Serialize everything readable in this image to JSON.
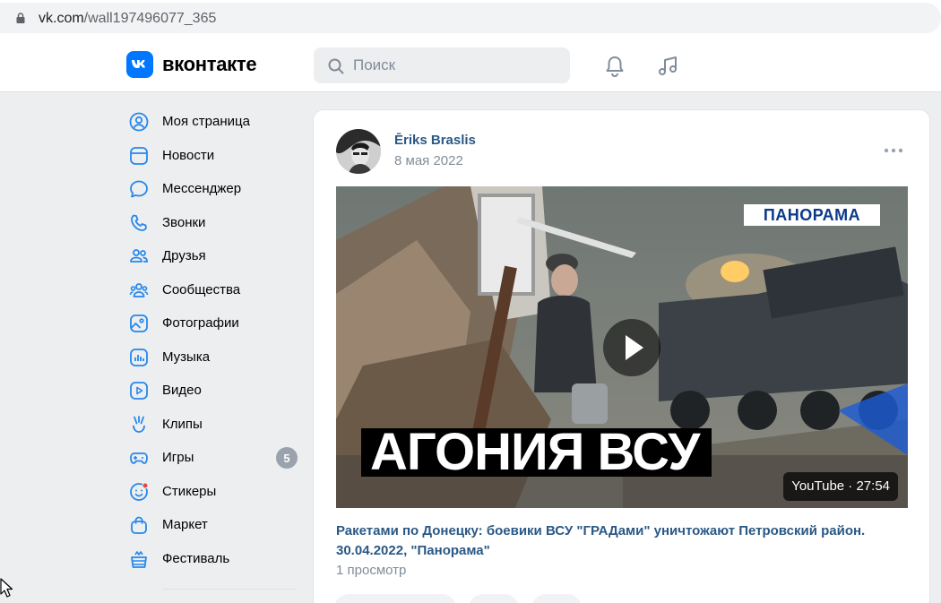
{
  "browser": {
    "url_host": "vk.com",
    "url_path": "/wall197496077_365"
  },
  "header": {
    "logo_text": "вконтакте",
    "search_placeholder": "Поиск"
  },
  "sidebar": {
    "items": [
      {
        "label": "Моя страница",
        "icon": "user-circle-icon"
      },
      {
        "label": "Новости",
        "icon": "news-icon"
      },
      {
        "label": "Мессенджер",
        "icon": "message-icon"
      },
      {
        "label": "Звонки",
        "icon": "phone-icon"
      },
      {
        "label": "Друзья",
        "icon": "friends-icon"
      },
      {
        "label": "Сообщества",
        "icon": "communities-icon"
      },
      {
        "label": "Фотографии",
        "icon": "photo-icon"
      },
      {
        "label": "Музыка",
        "icon": "music-icon"
      },
      {
        "label": "Видео",
        "icon": "video-icon"
      },
      {
        "label": "Клипы",
        "icon": "clips-icon"
      },
      {
        "label": "Игры",
        "icon": "games-icon",
        "badge": "5"
      },
      {
        "label": "Стикеры",
        "icon": "stickers-icon"
      },
      {
        "label": "Маркет",
        "icon": "market-icon"
      },
      {
        "label": "Фестиваль",
        "icon": "festival-icon"
      }
    ]
  },
  "post": {
    "author": "Ēriks Braslis",
    "date": "8 мая 2022",
    "video": {
      "channel": "ПАНОРАМА",
      "caption": "АГОНИЯ ВСУ",
      "duration": "YouTube · 27:54"
    },
    "title": "Ракетами по Донецку: боевики ВСУ \"ГРАДами\" уничтожают Петровский район. 30.04.2022, \"Панорама\"",
    "views": "1 просмотр"
  },
  "colors": {
    "accent": "#0077ff",
    "link": "#2a5885",
    "muted": "#818c99",
    "page_bg": "#edeef0"
  }
}
